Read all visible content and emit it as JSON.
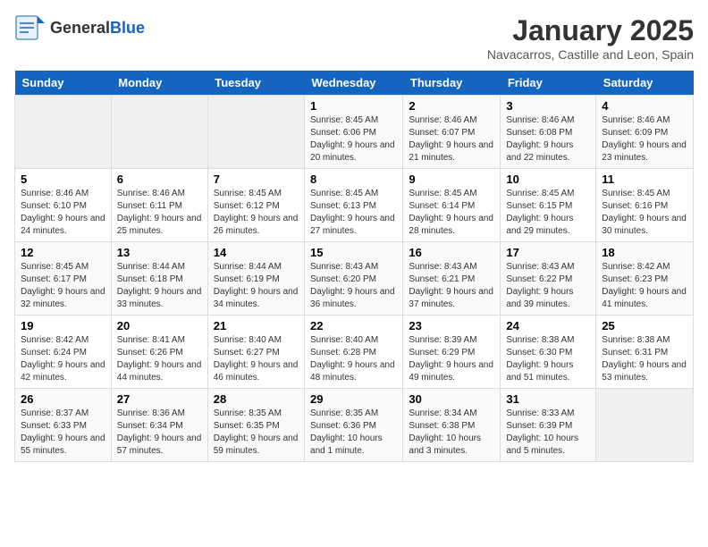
{
  "logo": {
    "general": "General",
    "blue": "Blue"
  },
  "title": "January 2025",
  "subtitle": "Navacarros, Castille and Leon, Spain",
  "days_of_week": [
    "Sunday",
    "Monday",
    "Tuesday",
    "Wednesday",
    "Thursday",
    "Friday",
    "Saturday"
  ],
  "weeks": [
    {
      "days": [
        {
          "num": "",
          "info": ""
        },
        {
          "num": "",
          "info": ""
        },
        {
          "num": "",
          "info": ""
        },
        {
          "num": "1",
          "info": "Sunrise: 8:45 AM\nSunset: 6:06 PM\nDaylight: 9 hours and 20 minutes."
        },
        {
          "num": "2",
          "info": "Sunrise: 8:46 AM\nSunset: 6:07 PM\nDaylight: 9 hours and 21 minutes."
        },
        {
          "num": "3",
          "info": "Sunrise: 8:46 AM\nSunset: 6:08 PM\nDaylight: 9 hours and 22 minutes."
        },
        {
          "num": "4",
          "info": "Sunrise: 8:46 AM\nSunset: 6:09 PM\nDaylight: 9 hours and 23 minutes."
        }
      ]
    },
    {
      "days": [
        {
          "num": "5",
          "info": "Sunrise: 8:46 AM\nSunset: 6:10 PM\nDaylight: 9 hours and 24 minutes."
        },
        {
          "num": "6",
          "info": "Sunrise: 8:46 AM\nSunset: 6:11 PM\nDaylight: 9 hours and 25 minutes."
        },
        {
          "num": "7",
          "info": "Sunrise: 8:45 AM\nSunset: 6:12 PM\nDaylight: 9 hours and 26 minutes."
        },
        {
          "num": "8",
          "info": "Sunrise: 8:45 AM\nSunset: 6:13 PM\nDaylight: 9 hours and 27 minutes."
        },
        {
          "num": "9",
          "info": "Sunrise: 8:45 AM\nSunset: 6:14 PM\nDaylight: 9 hours and 28 minutes."
        },
        {
          "num": "10",
          "info": "Sunrise: 8:45 AM\nSunset: 6:15 PM\nDaylight: 9 hours and 29 minutes."
        },
        {
          "num": "11",
          "info": "Sunrise: 8:45 AM\nSunset: 6:16 PM\nDaylight: 9 hours and 30 minutes."
        }
      ]
    },
    {
      "days": [
        {
          "num": "12",
          "info": "Sunrise: 8:45 AM\nSunset: 6:17 PM\nDaylight: 9 hours and 32 minutes."
        },
        {
          "num": "13",
          "info": "Sunrise: 8:44 AM\nSunset: 6:18 PM\nDaylight: 9 hours and 33 minutes."
        },
        {
          "num": "14",
          "info": "Sunrise: 8:44 AM\nSunset: 6:19 PM\nDaylight: 9 hours and 34 minutes."
        },
        {
          "num": "15",
          "info": "Sunrise: 8:43 AM\nSunset: 6:20 PM\nDaylight: 9 hours and 36 minutes."
        },
        {
          "num": "16",
          "info": "Sunrise: 8:43 AM\nSunset: 6:21 PM\nDaylight: 9 hours and 37 minutes."
        },
        {
          "num": "17",
          "info": "Sunrise: 8:43 AM\nSunset: 6:22 PM\nDaylight: 9 hours and 39 minutes."
        },
        {
          "num": "18",
          "info": "Sunrise: 8:42 AM\nSunset: 6:23 PM\nDaylight: 9 hours and 41 minutes."
        }
      ]
    },
    {
      "days": [
        {
          "num": "19",
          "info": "Sunrise: 8:42 AM\nSunset: 6:24 PM\nDaylight: 9 hours and 42 minutes."
        },
        {
          "num": "20",
          "info": "Sunrise: 8:41 AM\nSunset: 6:26 PM\nDaylight: 9 hours and 44 minutes."
        },
        {
          "num": "21",
          "info": "Sunrise: 8:40 AM\nSunset: 6:27 PM\nDaylight: 9 hours and 46 minutes."
        },
        {
          "num": "22",
          "info": "Sunrise: 8:40 AM\nSunset: 6:28 PM\nDaylight: 9 hours and 48 minutes."
        },
        {
          "num": "23",
          "info": "Sunrise: 8:39 AM\nSunset: 6:29 PM\nDaylight: 9 hours and 49 minutes."
        },
        {
          "num": "24",
          "info": "Sunrise: 8:38 AM\nSunset: 6:30 PM\nDaylight: 9 hours and 51 minutes."
        },
        {
          "num": "25",
          "info": "Sunrise: 8:38 AM\nSunset: 6:31 PM\nDaylight: 9 hours and 53 minutes."
        }
      ]
    },
    {
      "days": [
        {
          "num": "26",
          "info": "Sunrise: 8:37 AM\nSunset: 6:33 PM\nDaylight: 9 hours and 55 minutes."
        },
        {
          "num": "27",
          "info": "Sunrise: 8:36 AM\nSunset: 6:34 PM\nDaylight: 9 hours and 57 minutes."
        },
        {
          "num": "28",
          "info": "Sunrise: 8:35 AM\nSunset: 6:35 PM\nDaylight: 9 hours and 59 minutes."
        },
        {
          "num": "29",
          "info": "Sunrise: 8:35 AM\nSunset: 6:36 PM\nDaylight: 10 hours and 1 minute."
        },
        {
          "num": "30",
          "info": "Sunrise: 8:34 AM\nSunset: 6:38 PM\nDaylight: 10 hours and 3 minutes."
        },
        {
          "num": "31",
          "info": "Sunrise: 8:33 AM\nSunset: 6:39 PM\nDaylight: 10 hours and 5 minutes."
        },
        {
          "num": "",
          "info": ""
        }
      ]
    }
  ]
}
